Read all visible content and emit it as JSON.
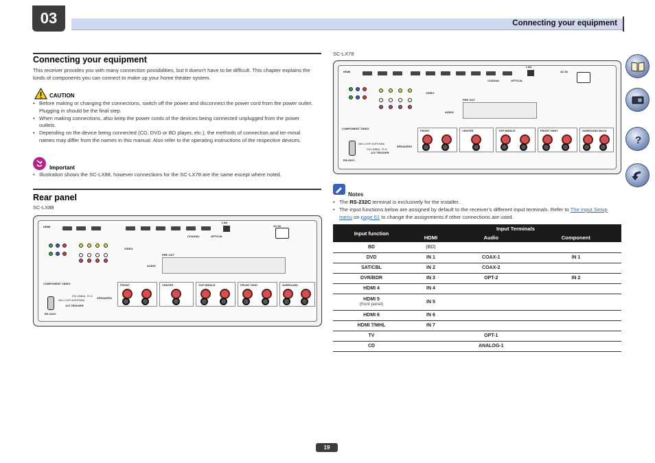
{
  "chapter": "03",
  "header": {
    "title": "Connecting your equipment"
  },
  "side_nav": [
    {
      "icon": "book-icon"
    },
    {
      "icon": "receiver-icon"
    },
    {
      "icon": "question-icon"
    },
    {
      "icon": "back-arrow-icon"
    }
  ],
  "section1": {
    "title": "Connecting your equipment",
    "intro": "This receiver provides you with many connection possibilities, but it doesn’t have to be difficult. This chapter explains the kinds of components you can connect to make up your home theater system.",
    "caution_title": "CAUTION",
    "caution_items": [
      "Before making or changing the connections, switch off the power and disconnect the power cord from the power outlet. Plugging in should be the final step.",
      "When making connections, also keep the power cords of the devices being connected unplugged from the power outlets.",
      "Depending on the device being connected (CD, DVD or BD player, etc.), the methods of connection and ter-minal names may differ from the names in this manual. Also refer to the operating instructions of the respective devices."
    ],
    "important_title": "Important",
    "important_items": [
      "Illustration shows the SC-LX88, however connections for the SC-LX78 are the same except where noted."
    ]
  },
  "section2": {
    "title": "Rear panel",
    "model_lx88": "SC-LX88",
    "model_lx78": "SC-LX78"
  },
  "panel_labels": {
    "hdmi": "HDMI",
    "video": "VIDEO",
    "component_video": "COMPONENT VIDEO",
    "speakers": "SPEAKERS",
    "rs232c": "RS-232C",
    "front": "FRONT",
    "center": "CENTER",
    "top_middle": "TOP MIDDLE",
    "front_high": "FRONT HIGH",
    "surround": "SURROUND",
    "surround_back": "SURROUND BACK",
    "ac_in": "AC IN",
    "lan": "LAN",
    "optical": "OPTICAL",
    "coaxial": "COAXIAL",
    "pre_out": "PRE OUT",
    "audio": "AUDIO",
    "twelve_v_trigger": "12V TRIGGER",
    "am_loop": "AM LOOP ANTENNA",
    "fm_unbal": "FM UNBAL 75 Ω"
  },
  "notes": {
    "title": "Notes",
    "item1_prefix": "The ",
    "item1_bold": "RS-232C",
    "item1_suffix": " terminal is exclusively for the installer.",
    "item2_text1": "The input functions below are assigned by default to the receiver’s different input terminals. Refer to ",
    "item2_link1": "The Input Setup menu",
    "item2_text2": " on ",
    "item2_link2": "page 61",
    "item2_text3": " to change the assignments if other connections are used."
  },
  "table": {
    "header_input_function": "Input function",
    "header_input_terminals": "Input Terminals",
    "header_hdmi": "HDMI",
    "header_audio": "Audio",
    "header_component": "Component",
    "rows": [
      {
        "function": "BD",
        "sub": "",
        "hdmi": "(BD)",
        "audio": "",
        "component": ""
      },
      {
        "function": "DVD",
        "sub": "",
        "hdmi": "IN 1",
        "audio": "COAX-1",
        "component": "IN 1"
      },
      {
        "function": "SAT/CBL",
        "sub": "",
        "hdmi": "IN 2",
        "audio": "COAX-2",
        "component": ""
      },
      {
        "function": "DVR/BDR",
        "sub": "",
        "hdmi": "IN 3",
        "audio": "OPT-2",
        "component": "IN 2"
      },
      {
        "function": "HDMI 4",
        "sub": "",
        "hdmi": "IN 4",
        "audio": "",
        "component": ""
      },
      {
        "function": "HDMI 5",
        "sub": "(front panel)",
        "hdmi": "IN 5",
        "audio": "",
        "component": ""
      },
      {
        "function": "HDMI 6",
        "sub": "",
        "hdmi": "IN 6",
        "audio": "",
        "component": ""
      },
      {
        "function": "HDMI 7/MHL",
        "sub": "",
        "hdmi": "IN 7",
        "audio": "",
        "component": ""
      },
      {
        "function": "TV",
        "sub": "",
        "hdmi": "",
        "audio": "OPT-1",
        "component": ""
      },
      {
        "function": "CD",
        "sub": "",
        "hdmi": "",
        "audio": "ANALOG-1",
        "component": ""
      }
    ]
  },
  "page_number": "19"
}
